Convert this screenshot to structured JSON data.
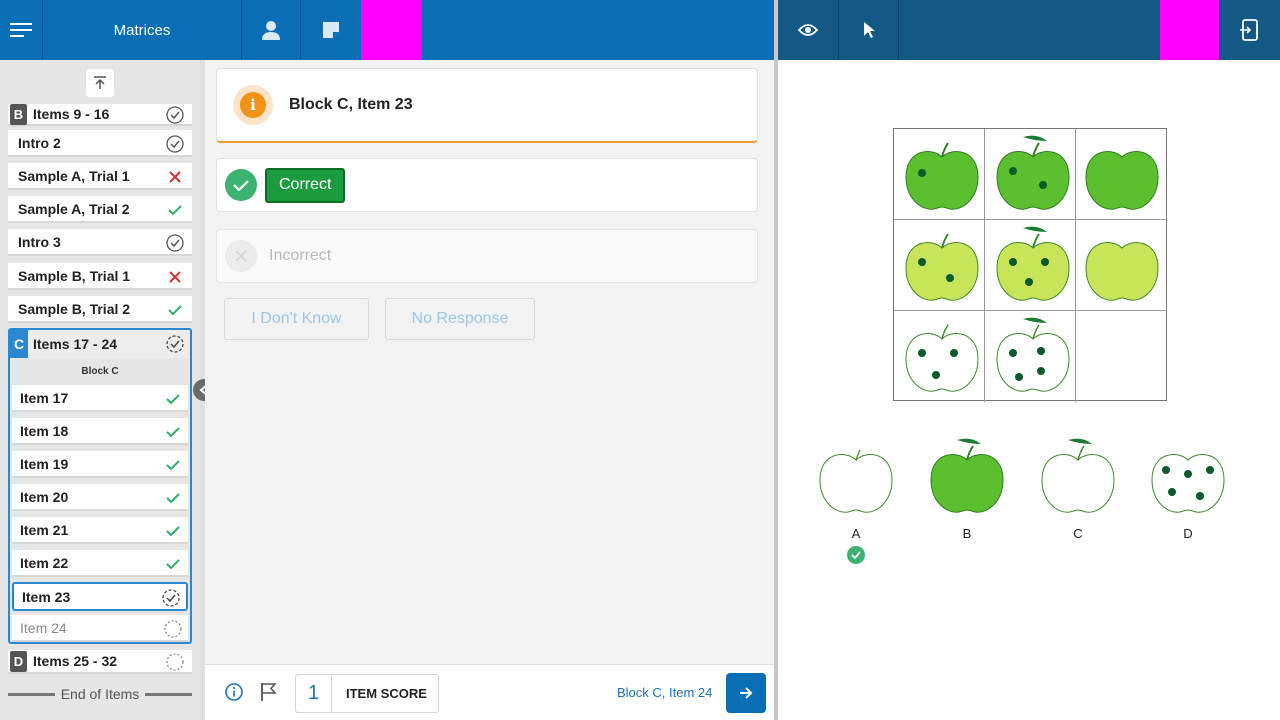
{
  "app": {
    "title": "Matrices"
  },
  "colors": {
    "primary": "#0a6eb4",
    "accent": "#ff00ff",
    "correct": "#1a9c3e",
    "warning": "#f39218"
  },
  "sidebar": {
    "items_top": [
      {
        "letter": "B",
        "label": "Items 9 - 16",
        "status": "circle-check-icon"
      },
      {
        "label": "Intro 2",
        "status": "circle-check-icon"
      },
      {
        "label": "Sample A, Trial 1",
        "status": "x-icon"
      },
      {
        "label": "Sample A, Trial 2",
        "status": "check-icon"
      },
      {
        "label": "Intro 3",
        "status": "circle-check-icon"
      },
      {
        "label": "Sample B, Trial 1",
        "status": "x-icon"
      },
      {
        "label": "Sample B, Trial 2",
        "status": "check-icon"
      }
    ],
    "block_c": {
      "letter": "C",
      "label": "Items 17 - 24",
      "sub": "Block C",
      "items": [
        {
          "label": "Item 17",
          "status": "check-icon"
        },
        {
          "label": "Item 18",
          "status": "check-icon"
        },
        {
          "label": "Item 19",
          "status": "check-icon"
        },
        {
          "label": "Item 20",
          "status": "check-icon"
        },
        {
          "label": "Item 21",
          "status": "check-icon"
        },
        {
          "label": "Item 22",
          "status": "check-icon"
        },
        {
          "label": "Item 23",
          "status": "dashed-check-icon"
        },
        {
          "label": "Item 24",
          "status": "dashed-circle-icon"
        }
      ]
    },
    "block_d": {
      "letter": "D",
      "label": "Items 25 - 32",
      "status": "dashed-circle-icon"
    },
    "end_label": "End of Items"
  },
  "main": {
    "item_title": "Block C, Item 23",
    "correct_label": "Correct",
    "incorrect_label": "Incorrect",
    "dont_know_label": "I Don't Know",
    "no_response_label": "No Response"
  },
  "footer": {
    "score": "1",
    "score_label": "ITEM SCORE",
    "next_item": "Block C, Item 24"
  },
  "stimulus": {
    "options": [
      "A",
      "B",
      "C",
      "D"
    ],
    "selected": "A"
  }
}
